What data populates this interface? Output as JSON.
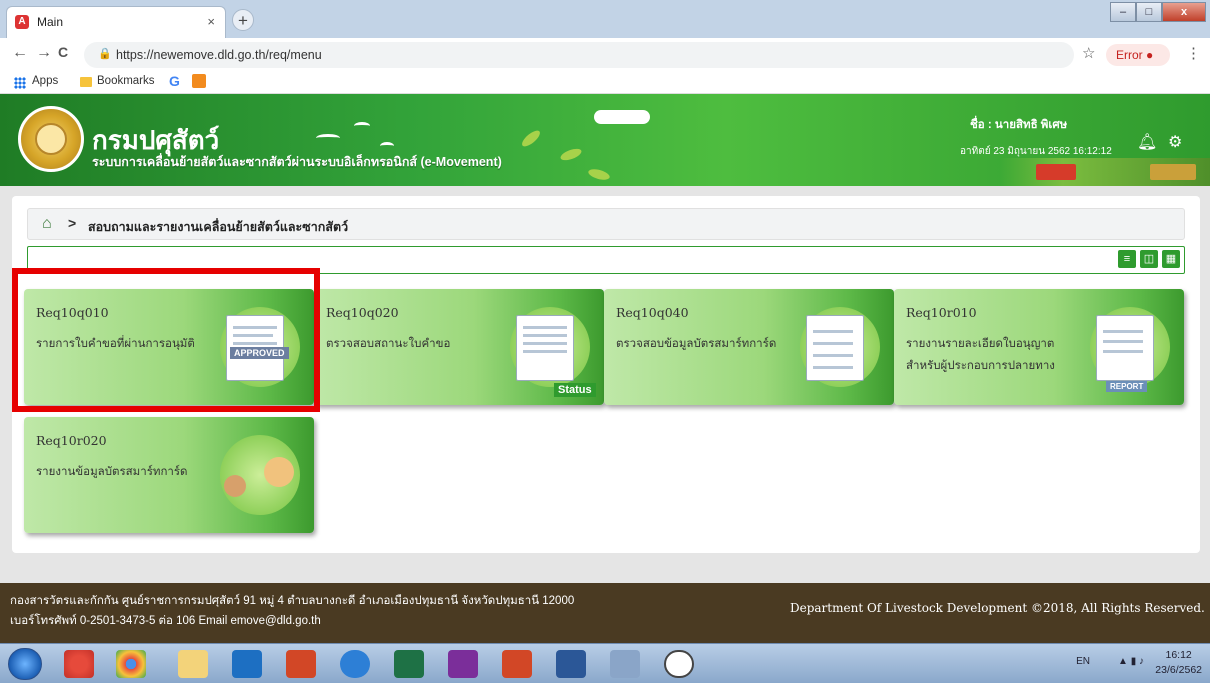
{
  "tab": {
    "title": "Main",
    "close": "×",
    "new_tab": "+"
  },
  "window": {
    "minimize": "–",
    "maximize": "□",
    "close": "x"
  },
  "toolbar": {
    "back": "←",
    "forward": "→",
    "reload": "C",
    "url": "https://newemove.dld.go.th/req/menu",
    "bookmark_star": "☆",
    "error_label": "Error",
    "menu": "⋮"
  },
  "bookmarks": {
    "apps": "Apps",
    "bookmarks": "Bookmarks",
    "google": "G"
  },
  "banner": {
    "department": "กรมปศุสัตว์",
    "system": "ระบบการเคลื่อนย้ายสัตว์และซากสัตว์ผ่านระบบอิเล็กทรอนิกส์ (e-Movement)",
    "user": "ชื่อ : นายสิทธิ พิเศษ",
    "datetime": "อาทิตย์ 23 มิถุนายน 2562 16:12:12"
  },
  "breadcrumb": {
    "text": "สอบถามและรายงานเคลื่อนย้ายสัตว์และซากสัตว์"
  },
  "view_buttons": [
    "≡",
    "◫",
    "▦"
  ],
  "cards": [
    {
      "code": "Req10q010",
      "name": "รายการใบคำขอที่ผ่านการอนุมัติ",
      "tag": "APPROVED"
    },
    {
      "code": "Req10q020",
      "name": "ตรวจสอบสถานะใบคำขอ",
      "tag": "Status"
    },
    {
      "code": "Req10q040",
      "name": "ตรวจสอบข้อมูลบัตรสมาร์ทการ์ด",
      "tag": ""
    },
    {
      "code": "Req10r010",
      "name": "รายงานรายละเอียดใบอนุญาตสำหรับผู้ประกอบการปลายทาง",
      "tag": "REPORT"
    },
    {
      "code": "Req10r020",
      "name": "รายงานข้อมูลบัตรสมาร์ทการ์ด",
      "tag": ""
    }
  ],
  "footer": {
    "line1": "กองสารวัตรและกักกัน ศูนย์ราชการกรมปศุสัตว์ 91 หมู่ 4 ตำบลบางกะดี อำเภอเมืองปทุมธานี จังหวัดปทุมธานี 12000",
    "line2": "เบอร์โทรศัพท์ 0-2501-3473-5 ต่อ 106 Email emove@dld.go.th",
    "rights": "Department Of Livestock Development ©2018, All Rights Reserved."
  },
  "taskbar": {
    "lang": "EN",
    "time": "16:12",
    "date": "23/6/2562"
  },
  "colors": {
    "brand_green": "#2f9b2e",
    "highlight_red": "#e60000",
    "footer_brown": "#4a3a22"
  }
}
